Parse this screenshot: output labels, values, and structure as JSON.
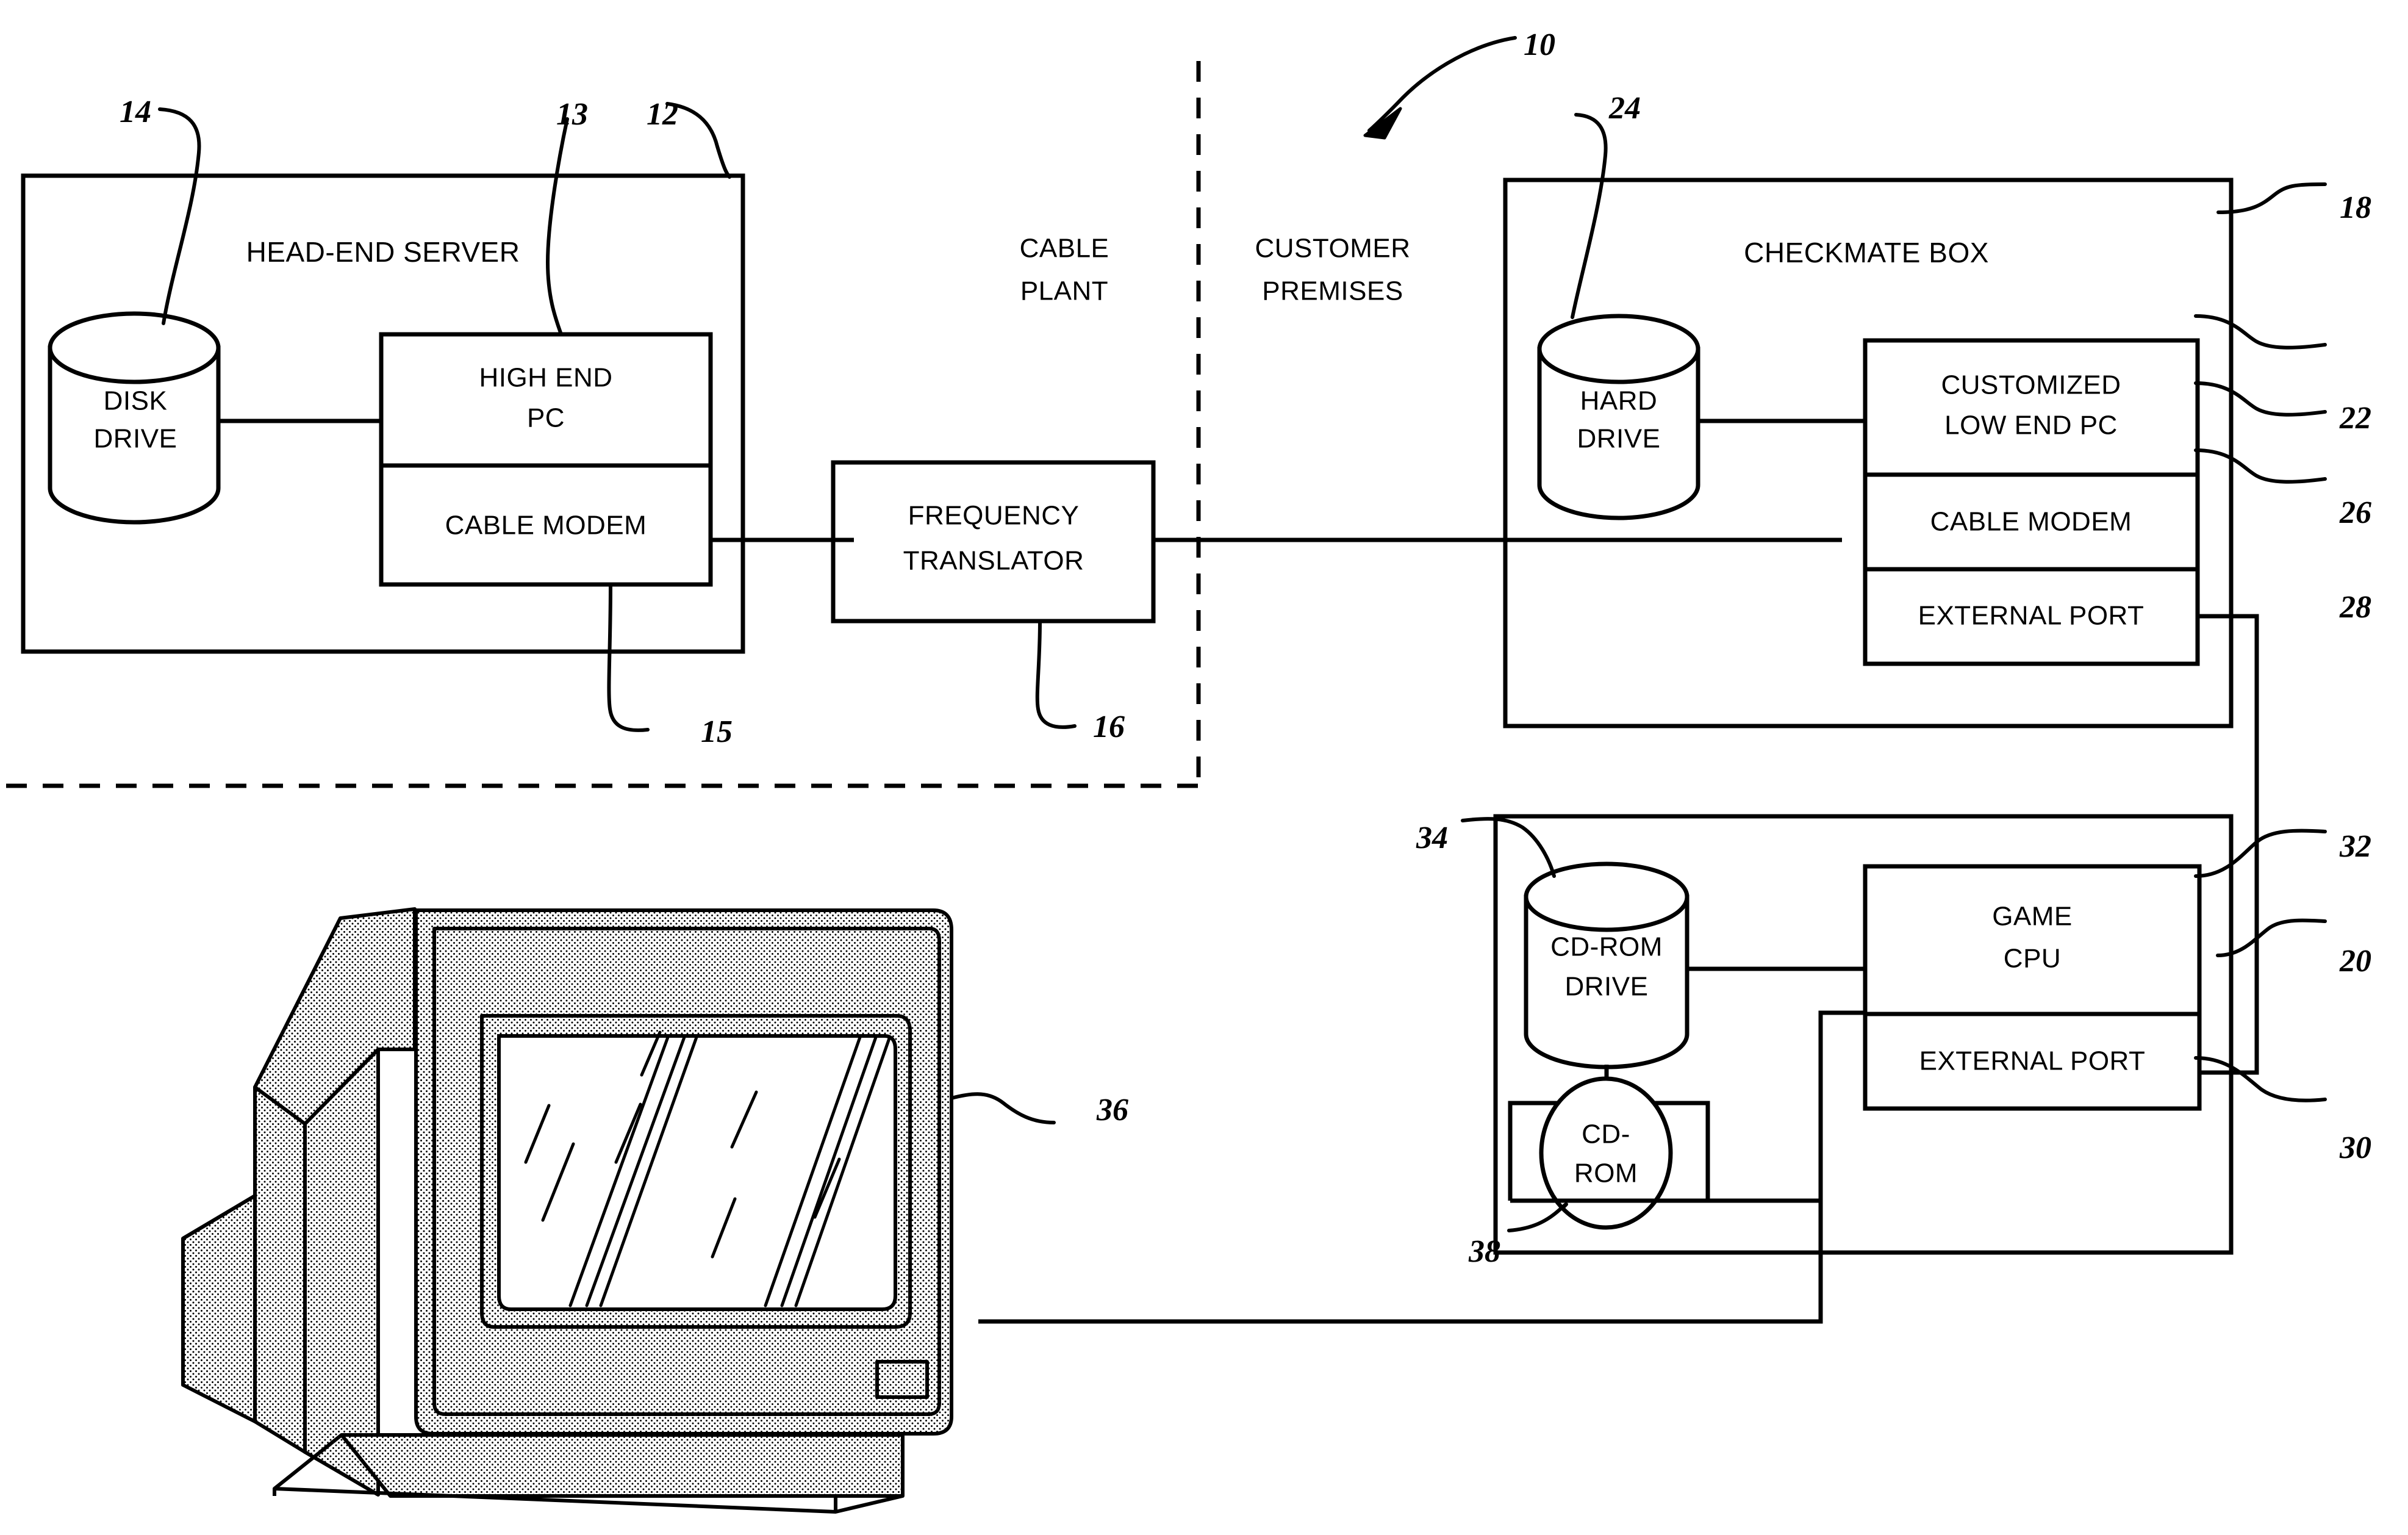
{
  "figure": {
    "title": "",
    "type": "patent-block-diagram"
  },
  "labels": {
    "head_end_server": "HEAD-END SERVER",
    "disk_drive": "DISK\nDRIVE",
    "disk_drive_line1": "DISK",
    "disk_drive_line2": "DRIVE",
    "high_end_pc_line1": "HIGH END",
    "high_end_pc_line2": "PC",
    "cable_modem_left": "CABLE MODEM",
    "cable_plant_line1": "CABLE",
    "cable_plant_line2": "PLANT",
    "customer_premises_line1": "CUSTOMER",
    "customer_premises_line2": "PREMISES",
    "frequency_translator_line1": "FREQUENCY",
    "frequency_translator_line2": "TRANSLATOR",
    "checkmate_box": "CHECKMATE BOX",
    "hard_drive_line1": "HARD",
    "hard_drive_line2": "DRIVE",
    "customized_low_end_pc_line1": "CUSTOMIZED",
    "customized_low_end_pc_line2": "LOW END PC",
    "cable_modem_right": "CABLE MODEM",
    "external_port_upper": "EXTERNAL PORT",
    "cdrom_drive_line1": "CD-ROM",
    "cdrom_drive_line2": "DRIVE",
    "game_cpu_line1": "GAME",
    "game_cpu_line2": "CPU",
    "external_port_lower": "EXTERNAL PORT",
    "cdrom_disc_line1": "CD-",
    "cdrom_disc_line2": "ROM"
  },
  "reference_numerals": {
    "system": "10",
    "head_end_server": "12",
    "high_end_pc": "13",
    "disk_drive": "14",
    "cable_modem_head_end": "15",
    "frequency_translator": "16",
    "checkmate_box": "18",
    "game_console": "20",
    "customized_low_end_pc": "22",
    "hard_drive": "24",
    "cable_modem_checkmate": "26",
    "external_port_checkmate": "28",
    "external_port_game": "30",
    "game_cpu": "32",
    "cdrom_drive": "34",
    "television": "36",
    "cdrom_disc": "38"
  },
  "colors": {
    "ink": "#000000",
    "paper": "#ffffff"
  }
}
